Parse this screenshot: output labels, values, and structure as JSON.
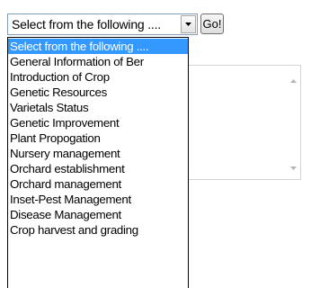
{
  "select": {
    "value": "Select from the following ...."
  },
  "go_button": {
    "label": "Go!"
  },
  "dropdown": {
    "selected_index": 0,
    "items": [
      "Select from the following ....",
      "General Information of Ber",
      "Introduction of Crop",
      "Genetic Resources",
      "Varietals Status",
      "Genetic Improvement",
      "Plant Propogation",
      "Nursery management",
      "Orchard establishment",
      "Orchard management",
      "Inset-Pest Management",
      "Disease Management",
      "Crop harvest and grading"
    ]
  },
  "icons": {
    "dropdown": "chevron-down-icon",
    "scroll_up": "scroll-up-arrow-icon",
    "scroll_down": "scroll-down-arrow-icon"
  },
  "colors": {
    "selection": "#3399ff",
    "select_border": "#7f9db9"
  }
}
